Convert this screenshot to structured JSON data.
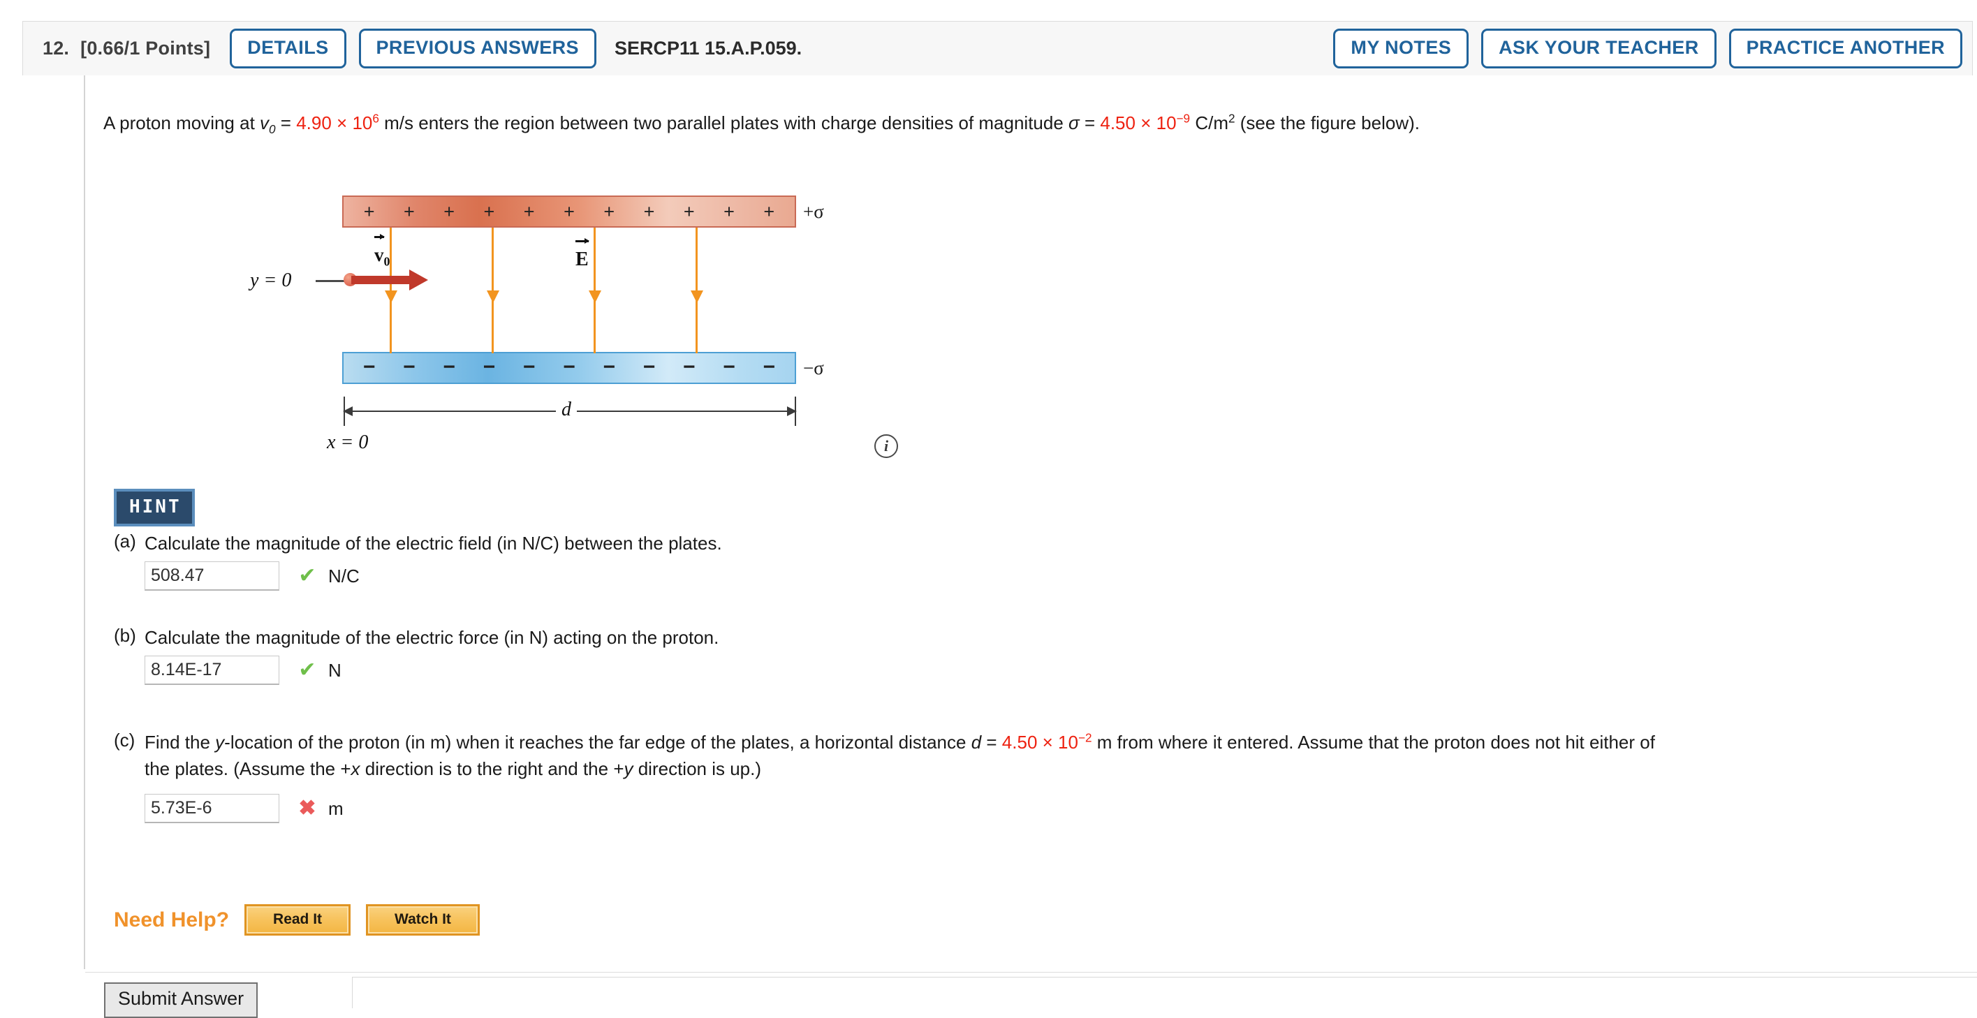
{
  "header": {
    "question_number": "12.",
    "points": "[0.66/1 Points]",
    "details_label": "DETAILS",
    "previous_answers_label": "PREVIOUS ANSWERS",
    "question_code": "SERCP11 15.A.P.059.",
    "my_notes_label": "MY NOTES",
    "ask_teacher_label": "ASK YOUR TEACHER",
    "practice_another_label": "PRACTICE ANOTHER"
  },
  "stem": {
    "t1": "A proton moving at ",
    "v_sym": "v",
    "v_sub": "0",
    "t2": " = ",
    "v_value": "4.90 × 10",
    "v_exp": "6",
    "t3": " m/s enters the region between two parallel plates with charge densities of magnitude ",
    "sigma_sym": "σ",
    "t4": " = ",
    "sigma_value": "4.50 × 10",
    "sigma_exp": "−9",
    "t5": " C/m",
    "unit_exp": "2",
    "t6": " (see the figure below)."
  },
  "figure": {
    "plus_sign": "+",
    "minus_sign": "−",
    "plus_count": 11,
    "minus_count": 11,
    "sigma_top_label": "+σ",
    "sigma_bottom_label": "−σ",
    "e_label": "E",
    "v_label_sym": "v",
    "v_label_sub": "0",
    "y_zero_label": "y = 0",
    "x_zero_label": "x = 0",
    "d_label": "d",
    "field_line_count": 4,
    "colors": {
      "plate_positive_border": "#c96a55",
      "plate_negative_border": "#4d9fd4",
      "field_line": "#f2941f",
      "velocity_arrow": "#c0392b"
    }
  },
  "info_icon_label": "i",
  "hint_label": "HINT",
  "parts": [
    {
      "label": "(a)",
      "text": "Calculate the magnitude of the electric field (in N/C) between the plates.",
      "answer": "508.47",
      "status": "correct",
      "mark": "✔",
      "unit": "N/C"
    },
    {
      "label": "(b)",
      "text": "Calculate the magnitude of the electric force (in N) acting on the proton.",
      "answer": "8.14E-17",
      "status": "correct",
      "mark": "✔",
      "unit": "N"
    },
    {
      "label": "(c)",
      "text_line1_a": "Find the ",
      "text_line1_ital1": "y",
      "text_line1_b": "-location of the proton (in m) when it reaches the far edge of the plates, a horizontal distance ",
      "text_line1_ital2": "d",
      "text_line1_c": " = ",
      "d_value": "4.50 × 10",
      "d_exp": "−2",
      "text_line1_d": " m from where it entered. Assume that the proton does not hit either of",
      "text_line2_a": "the plates. (Assume the +",
      "text_line2_ital1": "x",
      "text_line2_b": " direction is to the right and the +",
      "text_line2_ital2": "y",
      "text_line2_c": " direction is up.)",
      "answer": "5.73E-6",
      "status": "incorrect",
      "mark": "✖",
      "unit": "m"
    }
  ],
  "need_help": {
    "label": "Need Help?",
    "read_it_label": "Read It",
    "watch_it_label": "Watch It"
  },
  "submit_label": "Submit Answer",
  "colors": {
    "accent_blue": "#20639B",
    "value_red": "#ee2211",
    "hint_navy": "#2b4a6b",
    "help_orange": "#f0922b",
    "correct_green": "#6fbf4a",
    "incorrect_red": "#ea5a5a"
  }
}
